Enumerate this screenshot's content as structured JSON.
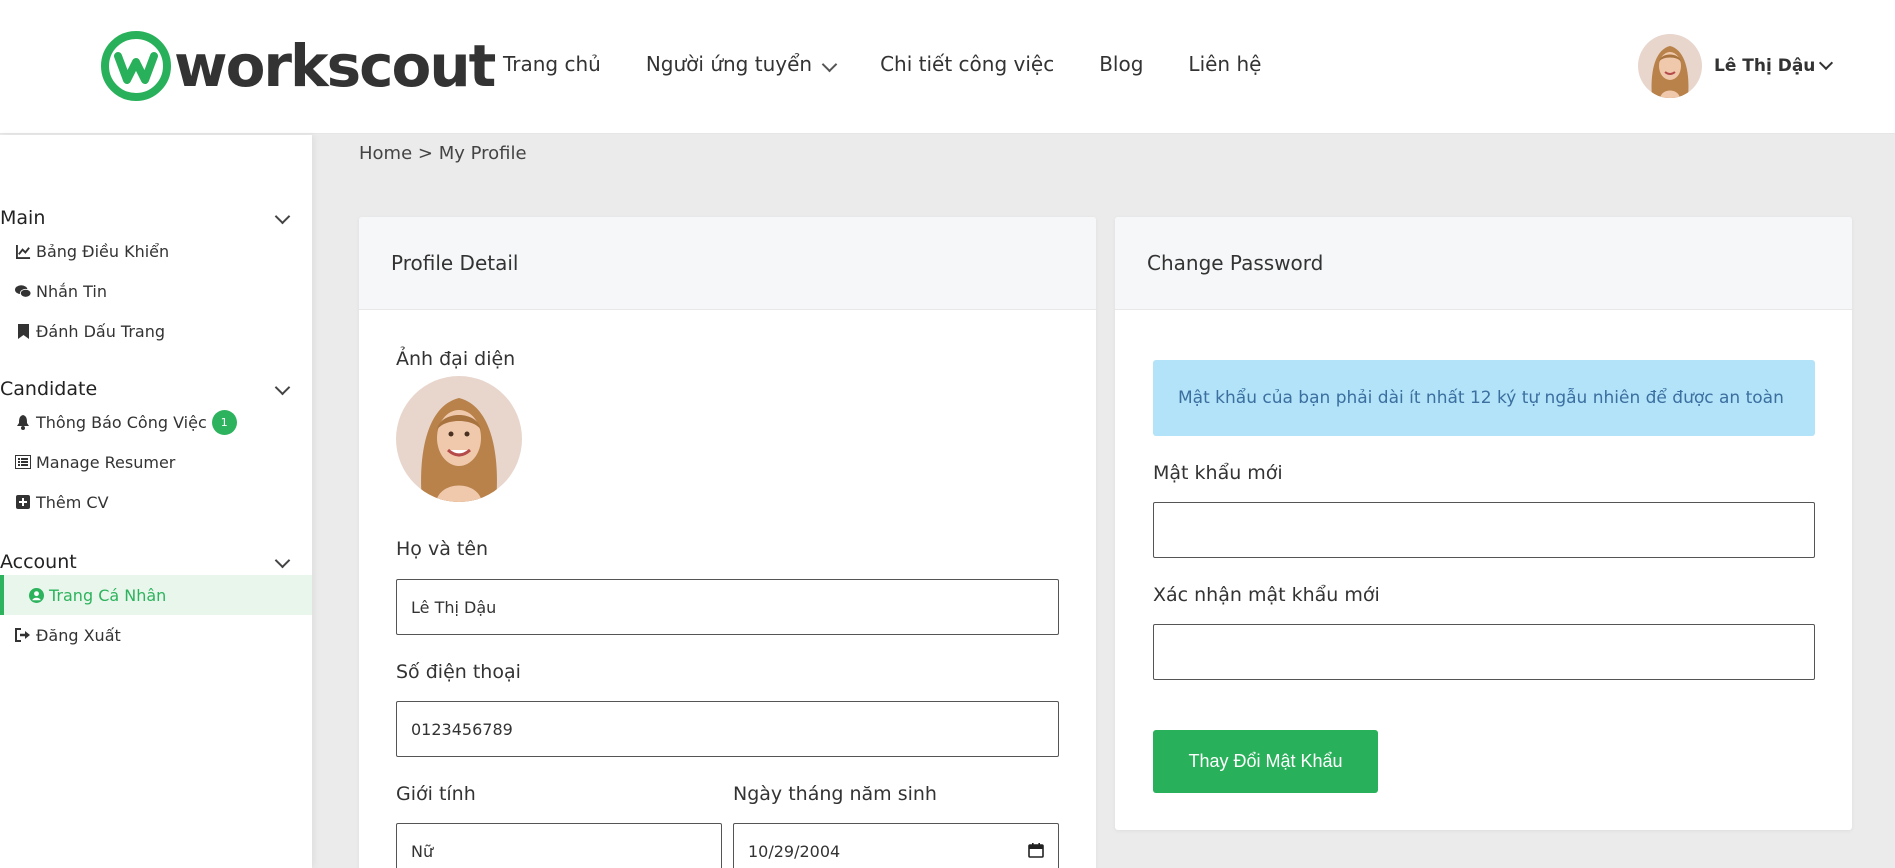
{
  "brand": {
    "name": "workscout",
    "accent": "#28b15a"
  },
  "nav": {
    "items": [
      {
        "label": "Trang chủ"
      },
      {
        "label": "Người ứng tuyển"
      },
      {
        "label": "Chi tiết công việc"
      },
      {
        "label": "Blog"
      },
      {
        "label": "Liên hệ"
      }
    ]
  },
  "user": {
    "name": "Lê Thị Dậu",
    "avatar": "avatar-photo"
  },
  "sidebar": {
    "sections": [
      {
        "title": "Main",
        "items": [
          {
            "label": "Bảng Điều Khiển",
            "icon": "chart-line-icon"
          },
          {
            "label": "Nhắn Tin",
            "icon": "chat-icon"
          },
          {
            "label": "Đánh Dấu Trang",
            "icon": "bookmark-icon"
          }
        ]
      },
      {
        "title": "Candidate",
        "items": [
          {
            "label": "Thông Báo Công Việc",
            "icon": "bell-icon",
            "badge": "1"
          },
          {
            "label": "Manage Resumer",
            "icon": "list-icon"
          },
          {
            "label": "Thêm CV",
            "icon": "plus-square-icon"
          }
        ]
      },
      {
        "title": "Account",
        "items": [
          {
            "label": "Trang Cá Nhân",
            "icon": "user-circle-icon",
            "active": true
          },
          {
            "label": "Đăng Xuất",
            "icon": "sign-out-icon"
          }
        ]
      }
    ]
  },
  "breadcrumb": {
    "home": "Home",
    "separator": " > ",
    "current": "My Profile"
  },
  "profile": {
    "title": "Profile Detail",
    "avatar_label": "Ảnh đại diện",
    "name_label": "Họ và tên",
    "name_value": "Lê Thị Dậu",
    "phone_label": "Số điện thoại",
    "phone_value": "0123456789",
    "gender_label": "Giới tính",
    "gender_value": "Nữ",
    "dob_label": "Ngày tháng năm sinh",
    "dob_value": "10/29/2004"
  },
  "password": {
    "title": "Change Password",
    "notice": "Mật khẩu của bạn phải dài ít nhất 12 ký tự ngẫu nhiên để được an toàn",
    "new_label": "Mật khẩu mới",
    "new_value": "",
    "confirm_label": "Xác nhận mật khẩu mới",
    "confirm_value": "",
    "submit_label": "Thay Đổi Mật Khẩu"
  }
}
